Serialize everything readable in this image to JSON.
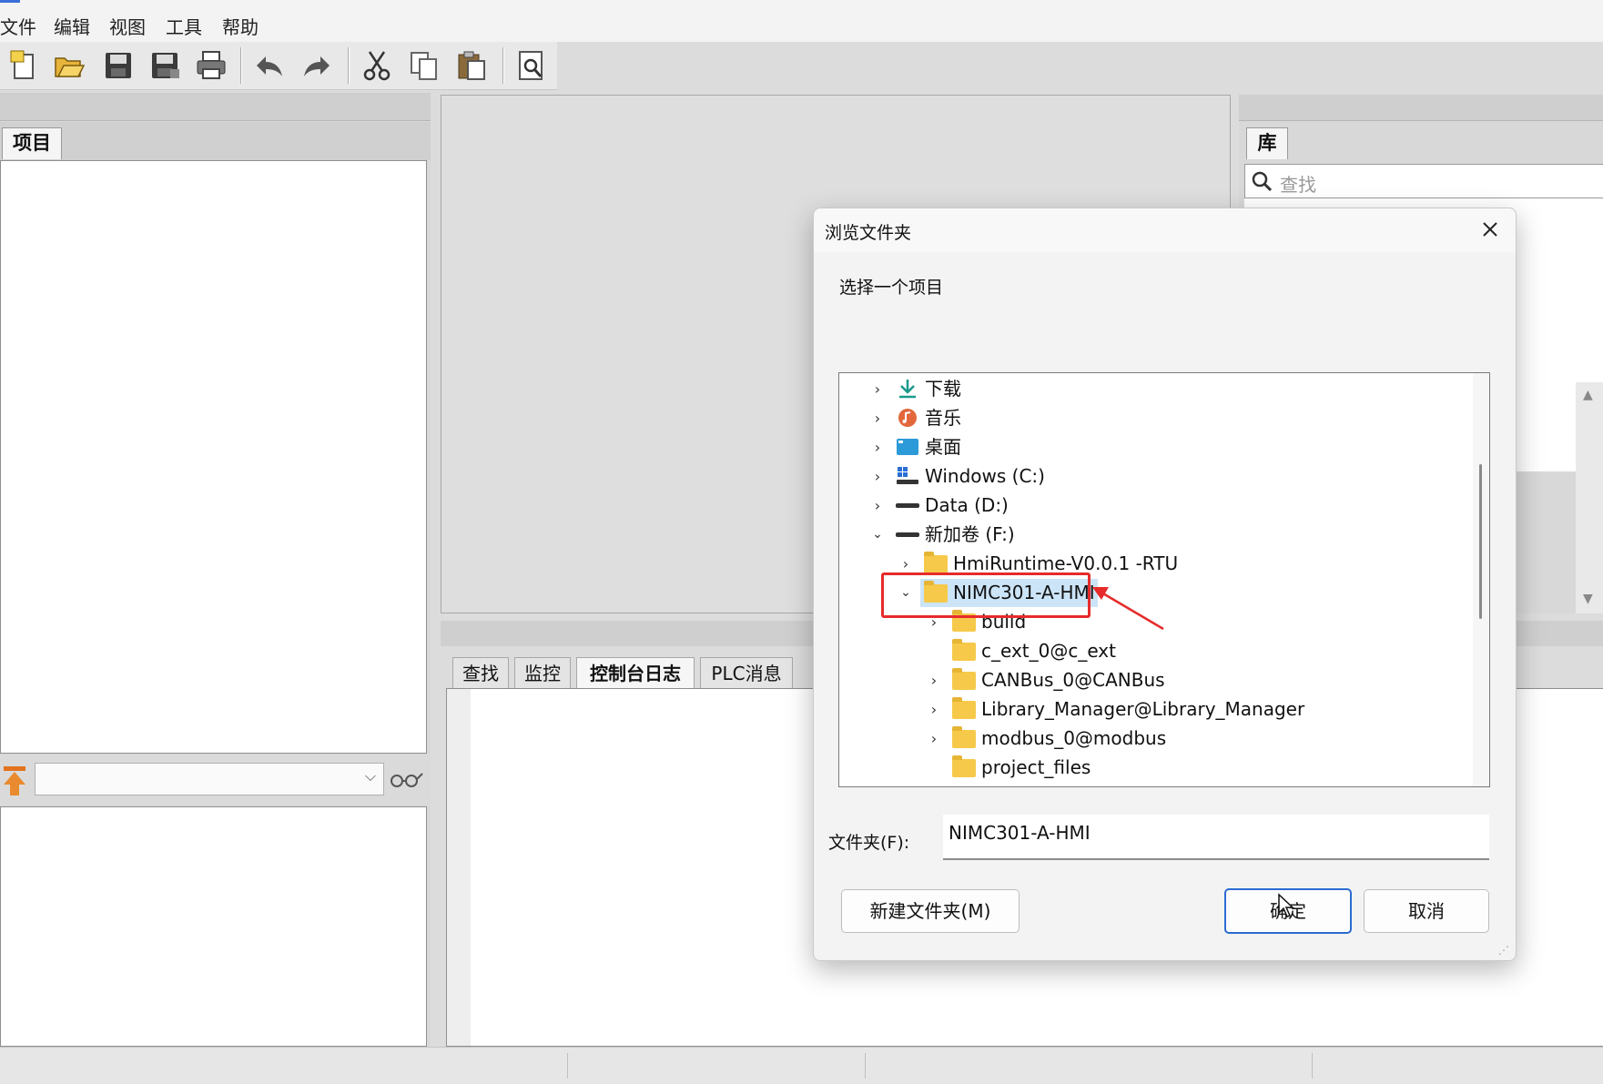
{
  "menu": [
    "文件",
    "编辑",
    "视图",
    "工具",
    "帮助"
  ],
  "toolbar_icons": [
    "new-file-icon",
    "open-folder-icon",
    "save-icon",
    "save-all-icon",
    "print-icon",
    "undo-icon",
    "redo-icon",
    "cut-icon",
    "copy-icon",
    "paste-icon",
    "preview-icon"
  ],
  "left_panel": {
    "tab_label": "项目"
  },
  "right_panel": {
    "tab_label": "库",
    "search_placeholder": "查找"
  },
  "bottom_tabs": [
    {
      "label": "查找",
      "active": false
    },
    {
      "label": "监控",
      "active": false
    },
    {
      "label": "控制台日志",
      "active": true
    },
    {
      "label": "PLC消息",
      "active": false
    }
  ],
  "dialog": {
    "title": "浏览文件夹",
    "instruction": "选择一个项目",
    "tree": [
      {
        "label": "下载",
        "icon": "download-icon",
        "expanded": false
      },
      {
        "label": "音乐",
        "icon": "music-icon",
        "expanded": false
      },
      {
        "label": "桌面",
        "icon": "desktop-icon",
        "expanded": false
      },
      {
        "label": "Windows (C:)",
        "icon": "windows-drive-icon",
        "expanded": false
      },
      {
        "label": "Data (D:)",
        "icon": "drive-icon",
        "expanded": false
      },
      {
        "label": "新加卷 (F:)",
        "icon": "drive-icon",
        "expanded": true
      },
      {
        "label": "HmiRuntime-V0.0.1 -RTU",
        "icon": "folder-icon",
        "expanded": false
      },
      {
        "label": "NIMC301-A-HMI",
        "icon": "folder-icon",
        "expanded": true,
        "selected": true
      },
      {
        "label": "build",
        "icon": "folder-icon",
        "expanded": false
      },
      {
        "label": "c_ext_0@c_ext",
        "icon": "folder-icon",
        "expanded": false
      },
      {
        "label": "CANBus_0@CANBus",
        "icon": "folder-icon",
        "expanded": false
      },
      {
        "label": "Library_Manager@Library_Manager",
        "icon": "folder-icon",
        "expanded": false
      },
      {
        "label": "modbus_0@modbus",
        "icon": "folder-icon",
        "expanded": false
      },
      {
        "label": "project_files",
        "icon": "folder-icon",
        "expanded": false
      }
    ],
    "folder_label": "文件夹(F):",
    "folder_value": "NIMC301-A-HMI",
    "new_folder_button": "新建文件夹(M)",
    "ok_button": "确定",
    "cancel_button": "取消"
  },
  "colors": {
    "highlight": "#e62b2b",
    "selection": "#cce4f7",
    "accent": "#2b6bd1"
  }
}
